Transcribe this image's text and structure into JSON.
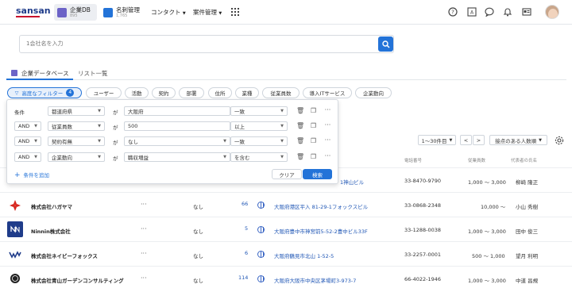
{
  "header": {
    "logo": "sansan",
    "apps": [
      {
        "name": "企業DB",
        "sub": "895"
      },
      {
        "name": "名刺管理",
        "sub": "1,765"
      }
    ],
    "menus": [
      "コンタクト",
      "案件管理"
    ]
  },
  "search": {
    "placeholder": "1会社名を入力"
  },
  "tabs": [
    {
      "label": "企業データベース"
    },
    {
      "label": "リスト一覧"
    }
  ],
  "chips": {
    "advanced": "高度なフィルター",
    "advanced_count": "4",
    "items": [
      "ユーザー",
      "活動",
      "契約",
      "部署",
      "住所",
      "業種",
      "従業員数",
      "導入ITサービス",
      "企業動向"
    ]
  },
  "filter": {
    "label_condition": "条件",
    "ga": "が",
    "rows": [
      {
        "logic": "",
        "field": "都道府県",
        "value": "大阪府",
        "op": "一致"
      },
      {
        "logic": "AND",
        "field": "従業員数",
        "value": "500",
        "op": "以上"
      },
      {
        "logic": "AND",
        "field": "契約有無",
        "value": "なし",
        "op": "一致"
      },
      {
        "logic": "AND",
        "field": "企業動向",
        "value": "職収増益",
        "op": "を含む"
      }
    ],
    "add": "条件を追加",
    "clear": "クリア",
    "search": "検索",
    "more": "···"
  },
  "pager": {
    "range": "1〜30件目",
    "prev": "<",
    "next": ">",
    "sort": "接点のある人数順"
  },
  "columns": {
    "phone": "電話番号",
    "employees": "従業員数",
    "rep": "代表者の氏名"
  },
  "rows": [
    {
      "company": "",
      "contracts": "",
      "count": "",
      "address": "1神山ビル",
      "phone": "33-8470-9790",
      "employees": "1,000 〜 3,000",
      "rep": "柳崎 隆正"
    },
    {
      "company": "株式会社ハガヤマ",
      "more": "···",
      "contracts": "なし",
      "count": "66",
      "address": "大阪府港区平入 81-29-1フォックスビル",
      "phone": "33-0868-2348",
      "employees": "10,000 〜",
      "rep": "小山 秀樹"
    },
    {
      "company": "Ninnin株式会社",
      "more": "···",
      "contracts": "なし",
      "count": "5",
      "address": "大阪府豊中市神宮前5-52-2豊中ビル33F",
      "phone": "33-1288-0038",
      "employees": "1,000 〜 3,000",
      "rep": "田中 俊三"
    },
    {
      "company": "株式会社ネイビーフォックス",
      "more": "···",
      "contracts": "なし",
      "count": "6",
      "address": "大阪府鶴見市北山 1-52-5",
      "phone": "33-2257-0001",
      "employees": "500 〜 1,000",
      "rep": "望月 利明"
    },
    {
      "company": "株式会社青山ガーデンコンサルティング",
      "more": "···",
      "contracts": "なし",
      "count": "114",
      "address": "大阪府大阪市中央区茅場町3-973-7",
      "phone": "66-4022-1946",
      "employees": "1,000 〜 3,000",
      "rep": "中道 昌規"
    }
  ],
  "colors": {
    "accent": "#2373d8",
    "brand": "#1f3c8a",
    "brand_red": "#c8102e"
  }
}
